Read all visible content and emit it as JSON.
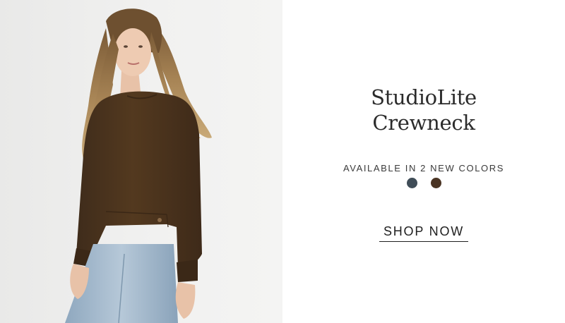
{
  "product": {
    "title_line1": "StudioLite",
    "title_line2": "Crewneck",
    "availability_text": "AVAILABLE IN 2 NEW COLORS",
    "swatches": [
      {
        "name": "slate-blue",
        "color": "#404d58"
      },
      {
        "name": "chocolate-brown",
        "color": "#4a3424"
      }
    ],
    "cta_label": "SHOP NOW"
  },
  "colors": {
    "sweater": "#4d3622",
    "jeans": "#9bb3c8",
    "background": "#efefee",
    "text": "#2b2b2b"
  }
}
